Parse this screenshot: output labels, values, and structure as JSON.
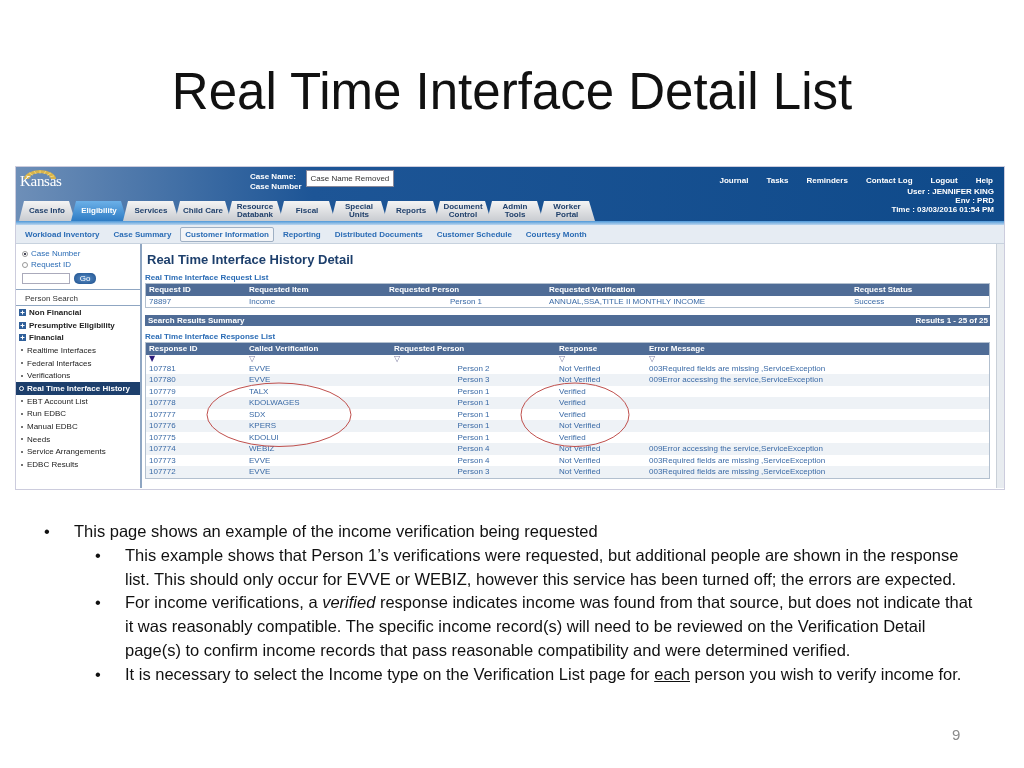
{
  "slide_title": "Real Time Interface Detail List",
  "app": {
    "logo": "Kansas",
    "case_fields": {
      "name_label": "Case Name:",
      "number_label": "Case Number",
      "value": "Case Name Removed"
    },
    "top_links": [
      "Journal",
      "Tasks",
      "Reminders",
      "Contact Log",
      "Logout",
      "Help"
    ],
    "user_info": [
      "User : JENNIFER KING",
      "Env : PRD",
      "Time : 03/03/2016 01:54 PM"
    ],
    "tabs": [
      {
        "label": "Case Info",
        "selected": false
      },
      {
        "label": "Eligibility",
        "selected": true
      },
      {
        "label": "Services",
        "selected": false
      },
      {
        "label": "Child Care",
        "selected": false
      },
      {
        "label": "Resource Databank",
        "selected": false
      },
      {
        "label": "Fiscal",
        "selected": false
      },
      {
        "label": "Special Units",
        "selected": false
      },
      {
        "label": "Reports",
        "selected": false
      },
      {
        "label": "Document Control",
        "selected": false
      },
      {
        "label": "Admin Tools",
        "selected": false
      },
      {
        "label": "Worker Portal",
        "selected": false
      }
    ],
    "subnav": [
      {
        "label": "Workload Inventory",
        "selected": false
      },
      {
        "label": "Case Summary",
        "selected": false
      },
      {
        "label": "Customer Information",
        "selected": true
      },
      {
        "label": "Reporting",
        "selected": false
      },
      {
        "label": "Distributed Documents",
        "selected": false
      },
      {
        "label": "Customer Schedule",
        "selected": false
      },
      {
        "label": "Courtesy Month",
        "selected": false
      }
    ],
    "sidebar": {
      "search_options": [
        {
          "label": "Case Number",
          "selected": true
        },
        {
          "label": "Request ID",
          "selected": false
        }
      ],
      "go_button": "Go",
      "person_search": "Person Search",
      "items": [
        {
          "kind": "group",
          "label": "Non Financial",
          "expanded": false
        },
        {
          "kind": "group",
          "label": "Presumptive Eligibility",
          "expanded": false
        },
        {
          "kind": "group",
          "label": "Financial",
          "expanded": false
        },
        {
          "kind": "link",
          "label": "Realtime Interfaces",
          "selected": false
        },
        {
          "kind": "link",
          "label": "Federal Interfaces",
          "selected": false
        },
        {
          "kind": "link",
          "label": "Verifications",
          "selected": false
        },
        {
          "kind": "link",
          "label": "Real Time Interface History",
          "selected": true
        },
        {
          "kind": "link",
          "label": "EBT Account List",
          "selected": false
        },
        {
          "kind": "link",
          "label": "Run EDBC",
          "selected": false
        },
        {
          "kind": "link",
          "label": "Manual EDBC",
          "selected": false
        },
        {
          "kind": "link",
          "label": "Needs",
          "selected": false
        },
        {
          "kind": "link",
          "label": "Service Arrangements",
          "selected": false
        },
        {
          "kind": "link",
          "label": "EDBC Results",
          "selected": false
        }
      ]
    },
    "page_title": "Real Time Interface History Detail",
    "request_list": {
      "title": "Real Time Interface Request List",
      "columns": [
        "Request ID",
        "Requested Item",
        "Requested Person",
        "Requested Verification",
        "Request Status"
      ],
      "rows": [
        [
          "78897",
          "Income",
          "Person 1",
          "ANNUAL,SSA,TITLE II MONTHLY INCOME",
          "Success"
        ]
      ]
    },
    "summary": {
      "title": "Search Results Summary",
      "results": "Results 1 - 25 of 25"
    },
    "response_list": {
      "title": "Real Time Interface Response List",
      "columns": [
        {
          "label": "Response ID",
          "sort": "▼"
        },
        {
          "label": "Called Verification",
          "sort": "▽"
        },
        {
          "label": "Requested Person",
          "sort": "▽"
        },
        {
          "label": "Response",
          "sort": "▽"
        },
        {
          "label": "Error Message",
          "sort": "▽"
        }
      ],
      "rows": [
        {
          "circled": false,
          "cells": [
            "107781",
            "EVVE",
            "Person 2",
            "Not Verified",
            "003Required fields are missing ,ServiceException"
          ]
        },
        {
          "circled": false,
          "cells": [
            "107780",
            "EVVE",
            "Person 3",
            "Not Verified",
            "009Error accessing the service,ServiceException"
          ]
        },
        {
          "circled": true,
          "cells": [
            "107779",
            "TALX",
            "Person 1",
            "Verified",
            ""
          ]
        },
        {
          "circled": true,
          "cells": [
            "107778",
            "KDOLWAGES",
            "Person 1",
            "Verified",
            ""
          ]
        },
        {
          "circled": true,
          "cells": [
            "107777",
            "SDX",
            "Person 1",
            "Verified",
            ""
          ]
        },
        {
          "circled": true,
          "cells": [
            "107776",
            "KPERS",
            "Person 1",
            "Not Verified",
            ""
          ]
        },
        {
          "circled": true,
          "cells": [
            "107775",
            "KDOLUI",
            "Person 1",
            "Verified",
            ""
          ]
        },
        {
          "circled": false,
          "cells": [
            "107774",
            "WEBIZ",
            "Person 4",
            "Not Verified",
            "009Error accessing the service,ServiceException"
          ]
        },
        {
          "circled": false,
          "cells": [
            "107773",
            "EVVE",
            "Person 4",
            "Not Verified",
            "003Required fields are missing ,ServiceException"
          ]
        },
        {
          "circled": false,
          "cells": [
            "107772",
            "EVVE",
            "Person 3",
            "Not Verified",
            "003Required fields are missing ,ServiceException"
          ]
        }
      ]
    }
  },
  "notes": [
    {
      "bullet": "•",
      "text": "This page shows an example of the income verification being requested",
      "children": [
        {
          "bullet": "•",
          "text": "This example shows that Person 1’s verifications were requested, but additional people are shown in the response list. This should only occur for EVVE or WEBIZ, however this service has been turned off; the errors are expected."
        },
        {
          "bullet": "•",
          "text": "For income verifications, a *verified* response indicates income was found from that source, but does not indicate that it was reasonably compatible. The specific income record(s) will need to be reviewed on the Verification Detail page(s) to confirm income records that pass reasonable compatibility and were determined verified."
        },
        {
          "bullet": "•",
          "parts": [
            {
              "text": "It is necessary to select the Income type on the Verification List page for ",
              "underline": false
            },
            {
              "text": "each",
              "underline": true
            },
            {
              "text": " person you wish to verify income for.",
              "underline": false
            }
          ]
        }
      ]
    }
  ],
  "page_number": "9"
}
